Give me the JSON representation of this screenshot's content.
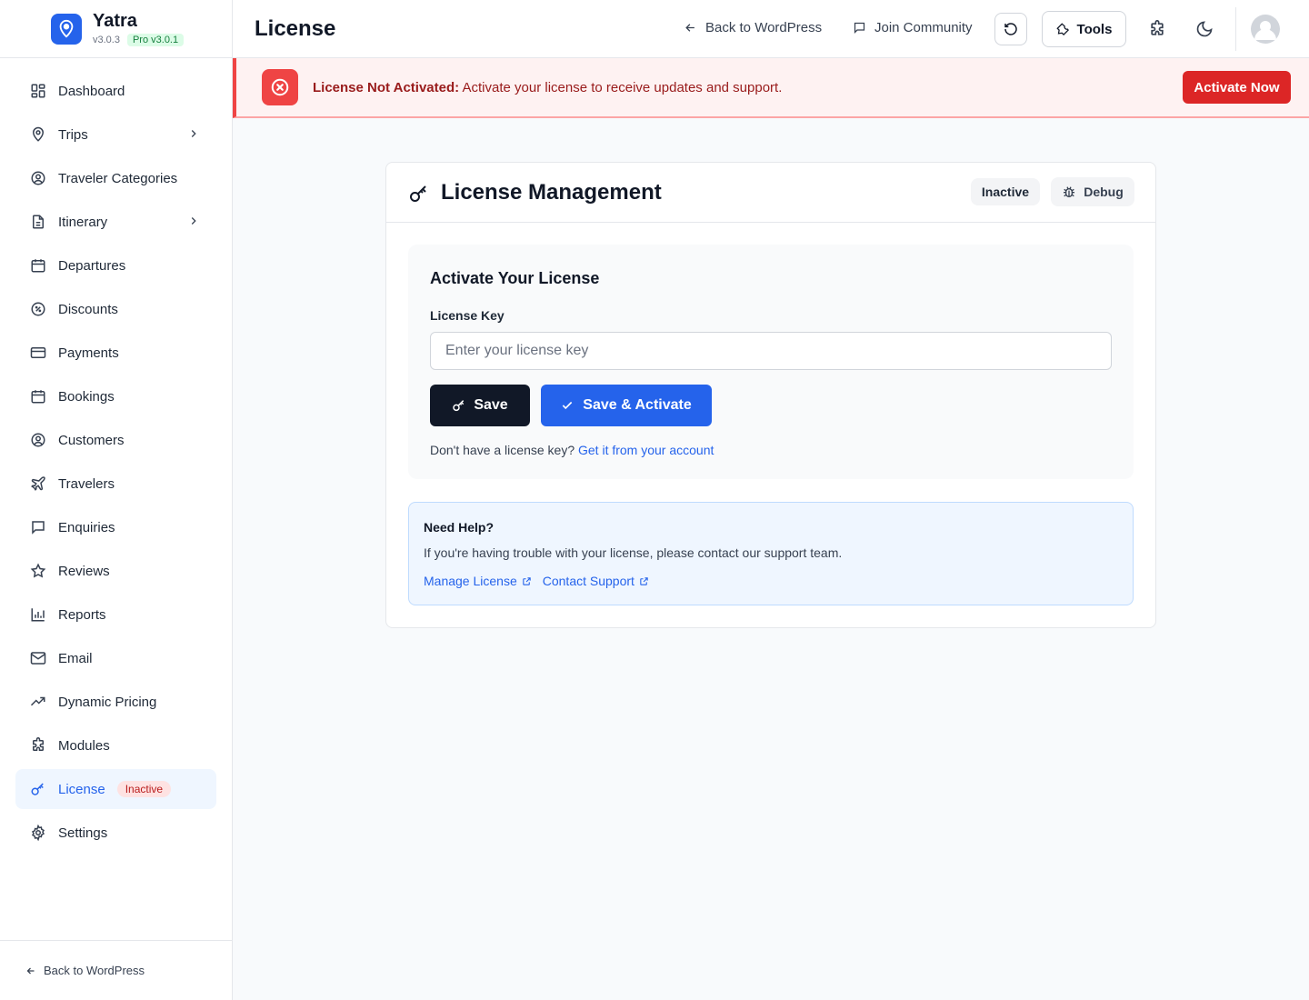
{
  "brand": {
    "name": "Yatra",
    "version": "v3.0.3",
    "pro_badge": "Pro v3.0.1"
  },
  "sidebar": {
    "items": [
      {
        "label": "Dashboard",
        "icon": "dashboard-icon"
      },
      {
        "label": "Trips",
        "icon": "map-pin-icon",
        "has_submenu": true
      },
      {
        "label": "Traveler Categories",
        "icon": "user-circle-icon"
      },
      {
        "label": "Itinerary",
        "icon": "document-icon",
        "has_submenu": true
      },
      {
        "label": "Departures",
        "icon": "calendar-icon"
      },
      {
        "label": "Discounts",
        "icon": "discount-icon"
      },
      {
        "label": "Payments",
        "icon": "credit-card-icon"
      },
      {
        "label": "Bookings",
        "icon": "calendar-icon"
      },
      {
        "label": "Customers",
        "icon": "user-circle-icon"
      },
      {
        "label": "Travelers",
        "icon": "plane-icon"
      },
      {
        "label": "Enquiries",
        "icon": "chat-icon"
      },
      {
        "label": "Reviews",
        "icon": "star-icon"
      },
      {
        "label": "Reports",
        "icon": "bar-chart-icon"
      },
      {
        "label": "Email",
        "icon": "mail-icon"
      },
      {
        "label": "Dynamic Pricing",
        "icon": "trend-icon"
      },
      {
        "label": "Modules",
        "icon": "puzzle-icon"
      },
      {
        "label": "License",
        "icon": "key-icon",
        "active": true,
        "badge": "Inactive"
      },
      {
        "label": "Settings",
        "icon": "gear-icon"
      }
    ],
    "footer_link": "Back to WordPress"
  },
  "topbar": {
    "title": "License",
    "back_link": "Back to WordPress",
    "community_link": "Join Community",
    "tools_label": "Tools"
  },
  "alert": {
    "title": "License Not Activated:",
    "message": "Activate your license to receive updates and support.",
    "button": "Activate Now",
    "color": "#dc2626"
  },
  "card": {
    "title": "License Management",
    "status": "Inactive",
    "debug_label": "Debug",
    "activate": {
      "title": "Activate Your License",
      "field_label": "License Key",
      "placeholder": "Enter your license key",
      "value": "",
      "save_label": "Save",
      "activate_label": "Save & Activate",
      "hint_text": "Don't have a license key?",
      "hint_link": "Get it from your account"
    },
    "help": {
      "title": "Need Help?",
      "text": "If you're having trouble with your license, please contact our support team.",
      "manage_link": "Manage License",
      "support_link": "Contact Support"
    }
  },
  "colors": {
    "accent": "#2563eb",
    "danger": "#ef4444",
    "dark": "#111827"
  }
}
